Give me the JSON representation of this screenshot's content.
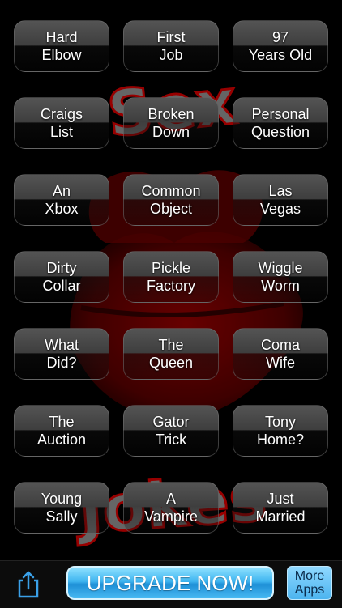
{
  "background": {
    "title_top": "Sex",
    "title_bottom": "Jokes",
    "lips_color": "#8a0000",
    "accent_red": "#a00000"
  },
  "buttons": [
    {
      "line1": "Hard",
      "line2": "Elbow"
    },
    {
      "line1": "First",
      "line2": "Job"
    },
    {
      "line1": "97",
      "line2": "Years Old"
    },
    {
      "line1": "Craigs",
      "line2": "List"
    },
    {
      "line1": "Broken",
      "line2": "Down"
    },
    {
      "line1": "Personal",
      "line2": "Question"
    },
    {
      "line1": "An",
      "line2": "Xbox"
    },
    {
      "line1": "Common",
      "line2": "Object"
    },
    {
      "line1": "Las",
      "line2": "Vegas"
    },
    {
      "line1": "Dirty",
      "line2": "Collar"
    },
    {
      "line1": "Pickle",
      "line2": "Factory"
    },
    {
      "line1": "Wiggle",
      "line2": "Worm"
    },
    {
      "line1": "What",
      "line2": "Did?"
    },
    {
      "line1": "The",
      "line2": "Queen"
    },
    {
      "line1": "Coma",
      "line2": "Wife"
    },
    {
      "line1": "The",
      "line2": "Auction"
    },
    {
      "line1": "Gator",
      "line2": "Trick"
    },
    {
      "line1": "Tony",
      "line2": "Home?"
    },
    {
      "line1": "Young",
      "line2": "Sally"
    },
    {
      "line1": "A",
      "line2": "Vampire"
    },
    {
      "line1": "Just",
      "line2": "Married"
    }
  ],
  "toolbar": {
    "share_icon": "share-icon",
    "upgrade_label": "UPGRADE NOW!",
    "more_line1": "More",
    "more_line2": "Apps",
    "upgrade_color": "#3fb5f0"
  }
}
